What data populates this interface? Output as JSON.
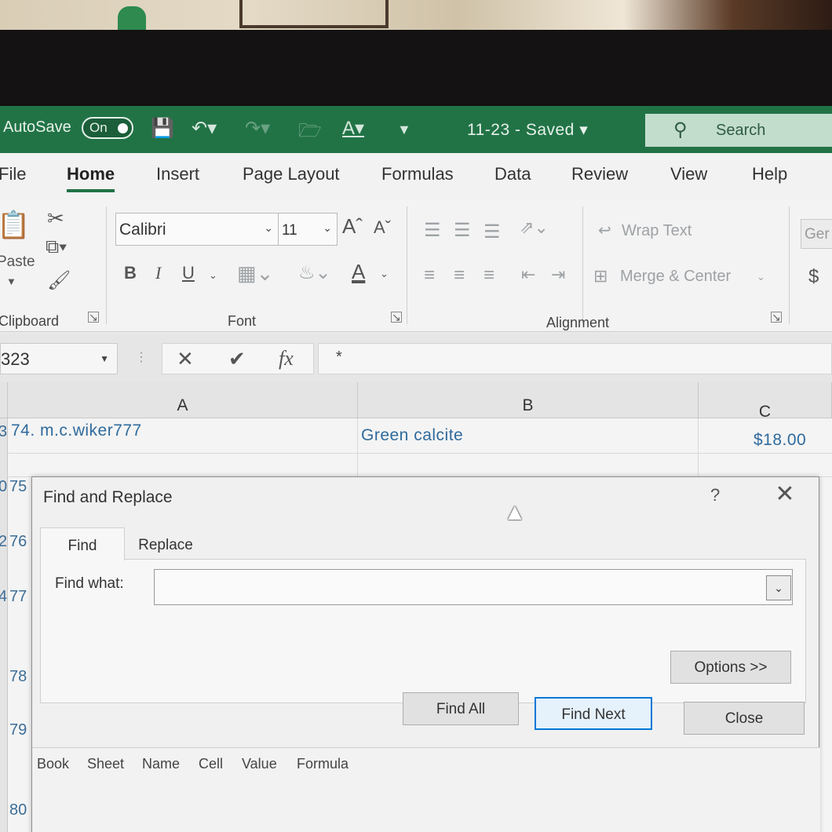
{
  "titlebar": {
    "autosave_label": "AutoSave",
    "autosave_state": "On",
    "doc_status": "11-23  -  Saved  ▾",
    "search_placeholder": "Search"
  },
  "menu": {
    "tabs": [
      "File",
      "Home",
      "Insert",
      "Page Layout",
      "Formulas",
      "Data",
      "Review",
      "View",
      "Help"
    ],
    "active": "Home"
  },
  "ribbon": {
    "clipboard": {
      "paste_label": "Paste",
      "group_label": "Clipboard"
    },
    "font": {
      "font_name": "Calibri",
      "font_size": "11",
      "bold": "B",
      "italic": "I",
      "underline": "U",
      "grow": "Aˆ",
      "shrink": "Aˇ",
      "font_color": "A",
      "group_label": "Font"
    },
    "alignment": {
      "wrap_text": "Wrap Text",
      "merge_center": "Merge & Center",
      "group_label": "Alignment"
    },
    "number": {
      "format": "Ger",
      "currency": "$"
    }
  },
  "formula_bar": {
    "name_box": "323",
    "cancel": "✕",
    "enter": "✔",
    "fx": "fx",
    "content": "*"
  },
  "sheet": {
    "columns": [
      "A",
      "B",
      "C"
    ],
    "row_numbers": [
      "75",
      "76",
      "77",
      "78",
      "79",
      "80"
    ],
    "row_prefixes": [
      "3",
      "0",
      "2",
      "4"
    ],
    "first_row": {
      "a": "74. m.c.wiker777",
      "b": "Green calcite",
      "c": "$18.00"
    }
  },
  "dialog": {
    "title": "Find and Replace",
    "help": "?",
    "close_glyph": "✕",
    "tabs": [
      "Find",
      "Replace"
    ],
    "active_tab": "Find",
    "find_label": "Find what:",
    "find_value": "",
    "options_button": "Options >>",
    "find_all_button": "Find All",
    "find_next_button": "Find Next",
    "close_button": "Close",
    "result_columns": [
      "Book",
      "Sheet",
      "Name",
      "Cell",
      "Value",
      "Formula"
    ]
  },
  "colors": {
    "excel_green": "#217346",
    "accent_blue": "#0078d7",
    "cell_text": "#2f6a9c"
  }
}
